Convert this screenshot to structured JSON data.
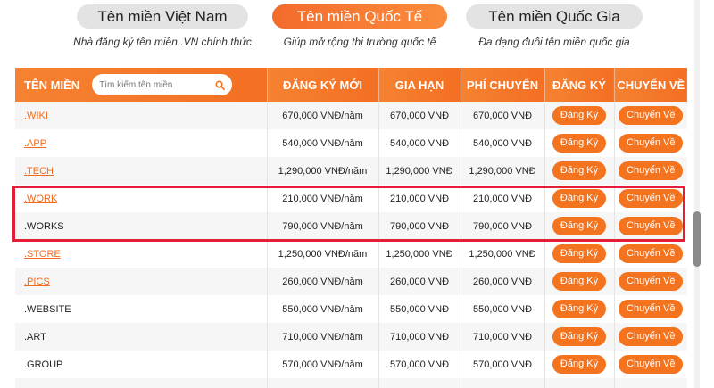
{
  "tabs": [
    {
      "label": "Tên miền Việt Nam",
      "subtitle": "Nhà đăng ký tên miền .VN chính thức",
      "active": false
    },
    {
      "label": "Tên miền Quốc Tế",
      "subtitle": "Giúp mở rộng thị trường quốc tế",
      "active": true
    },
    {
      "label": "Tên miền Quốc Gia",
      "subtitle": "Đa dạng đuôi tên miền quốc gia",
      "active": false
    }
  ],
  "table": {
    "headers": {
      "name": "TÊN MIỀN",
      "register": "ĐĂNG KÝ MỚI",
      "renew": "GIA HẠN",
      "transfer_fee": "PHÍ CHUYỂN",
      "register_action": "ĐĂNG KÝ",
      "transfer_action": "CHUYỂN VỀ"
    },
    "search_placeholder": "Tìm kiếm tên miền",
    "search_icon": "search-icon",
    "register_button": "Đăng Ký",
    "transfer_button": "Chuyển Về",
    "rows": [
      {
        "name": ".WIKI",
        "link": true,
        "register": "670,000 VNĐ/năm",
        "renew": "670,000 VNĐ",
        "transfer": "670,000 VNĐ"
      },
      {
        "name": ".APP",
        "link": true,
        "register": "540,000 VNĐ/năm",
        "renew": "540,000 VNĐ",
        "transfer": "540,000 VNĐ"
      },
      {
        "name": ".TECH",
        "link": true,
        "register": "1,290,000 VNĐ/năm",
        "renew": "1,290,000 VNĐ",
        "transfer": "1,290,000 VNĐ"
      },
      {
        "name": ".WORK",
        "link": true,
        "register": "210,000 VNĐ/năm",
        "renew": "210,000 VNĐ",
        "transfer": "210,000 VNĐ"
      },
      {
        "name": ".WORKS",
        "link": false,
        "register": "790,000 VNĐ/năm",
        "renew": "790,000 VNĐ",
        "transfer": "790,000 VNĐ"
      },
      {
        "name": ".STORE",
        "link": true,
        "register": "1,250,000 VNĐ/năm",
        "renew": "1,250,000 VNĐ",
        "transfer": "1,250,000 VNĐ"
      },
      {
        "name": ".PICS",
        "link": true,
        "register": "260,000 VNĐ/năm",
        "renew": "260,000 VNĐ",
        "transfer": "260,000 VNĐ"
      },
      {
        "name": ".WEBSITE",
        "link": false,
        "register": "550,000 VNĐ/năm",
        "renew": "550,000 VNĐ",
        "transfer": "550,000 VNĐ"
      },
      {
        "name": ".ART",
        "link": false,
        "register": "710,000 VNĐ/năm",
        "renew": "710,000 VNĐ",
        "transfer": "710,000 VNĐ"
      },
      {
        "name": ".GROUP",
        "link": false,
        "register": "570,000 VNĐ/năm",
        "renew": "570,000 VNĐ",
        "transfer": "570,000 VNĐ"
      },
      {
        "name": "",
        "link": false,
        "register": "",
        "renew": "",
        "transfer": ""
      }
    ]
  },
  "colors": {
    "accent": "#f4731e",
    "highlight_border": "#e41e37"
  }
}
